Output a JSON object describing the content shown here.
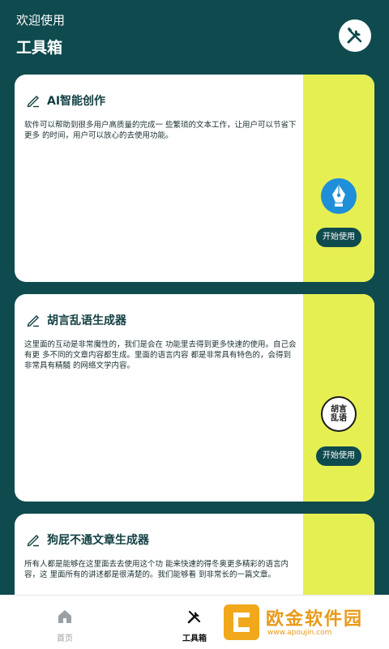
{
  "header": {
    "welcome": "欢迎使用",
    "title": "工具箱",
    "tool_icon": "tools-icon"
  },
  "cards": [
    {
      "title": "AI智能创作",
      "desc": "软件可以帮助到很多用户高质量的完成一 些繁琐的文本工作，让用户可以节省下更多 的时间，用户可以放心的去使用功能。",
      "button": "开始使用",
      "icon": "fountain-pen-icon"
    },
    {
      "title": "胡言乱语生成器",
      "desc": "这里面的互动是非常魔性的，我们是会在 功能里去得到更多快速的使用。自己会有更 多不同的文章内容都生成。里面的语言内容 都是非常具有特色的，会得到非常具有精髓 的网络文学内容。",
      "button": "开始使用",
      "icon_text": "胡言\n乱语"
    },
    {
      "title": "狗屁不通文章生成器",
      "desc": "所有人都是能够在这里面去去使用这个功 能来快速的得冬奥更多精彩的语言内容，这 里面所有的讲述都是很清楚的。我们能够看 到非常长的一篇文章。"
    }
  ],
  "tabs": [
    {
      "label": "首页",
      "icon": "home-icon",
      "active": false
    },
    {
      "label": "工具箱",
      "icon": "tools-icon",
      "active": true
    }
  ],
  "watermark": {
    "text": "欧金软件园",
    "url": "www.apoujin.com"
  },
  "colors": {
    "primary": "#0f4a4e",
    "accent": "#e6ef52",
    "icon_blue": "#1e8fd8"
  }
}
